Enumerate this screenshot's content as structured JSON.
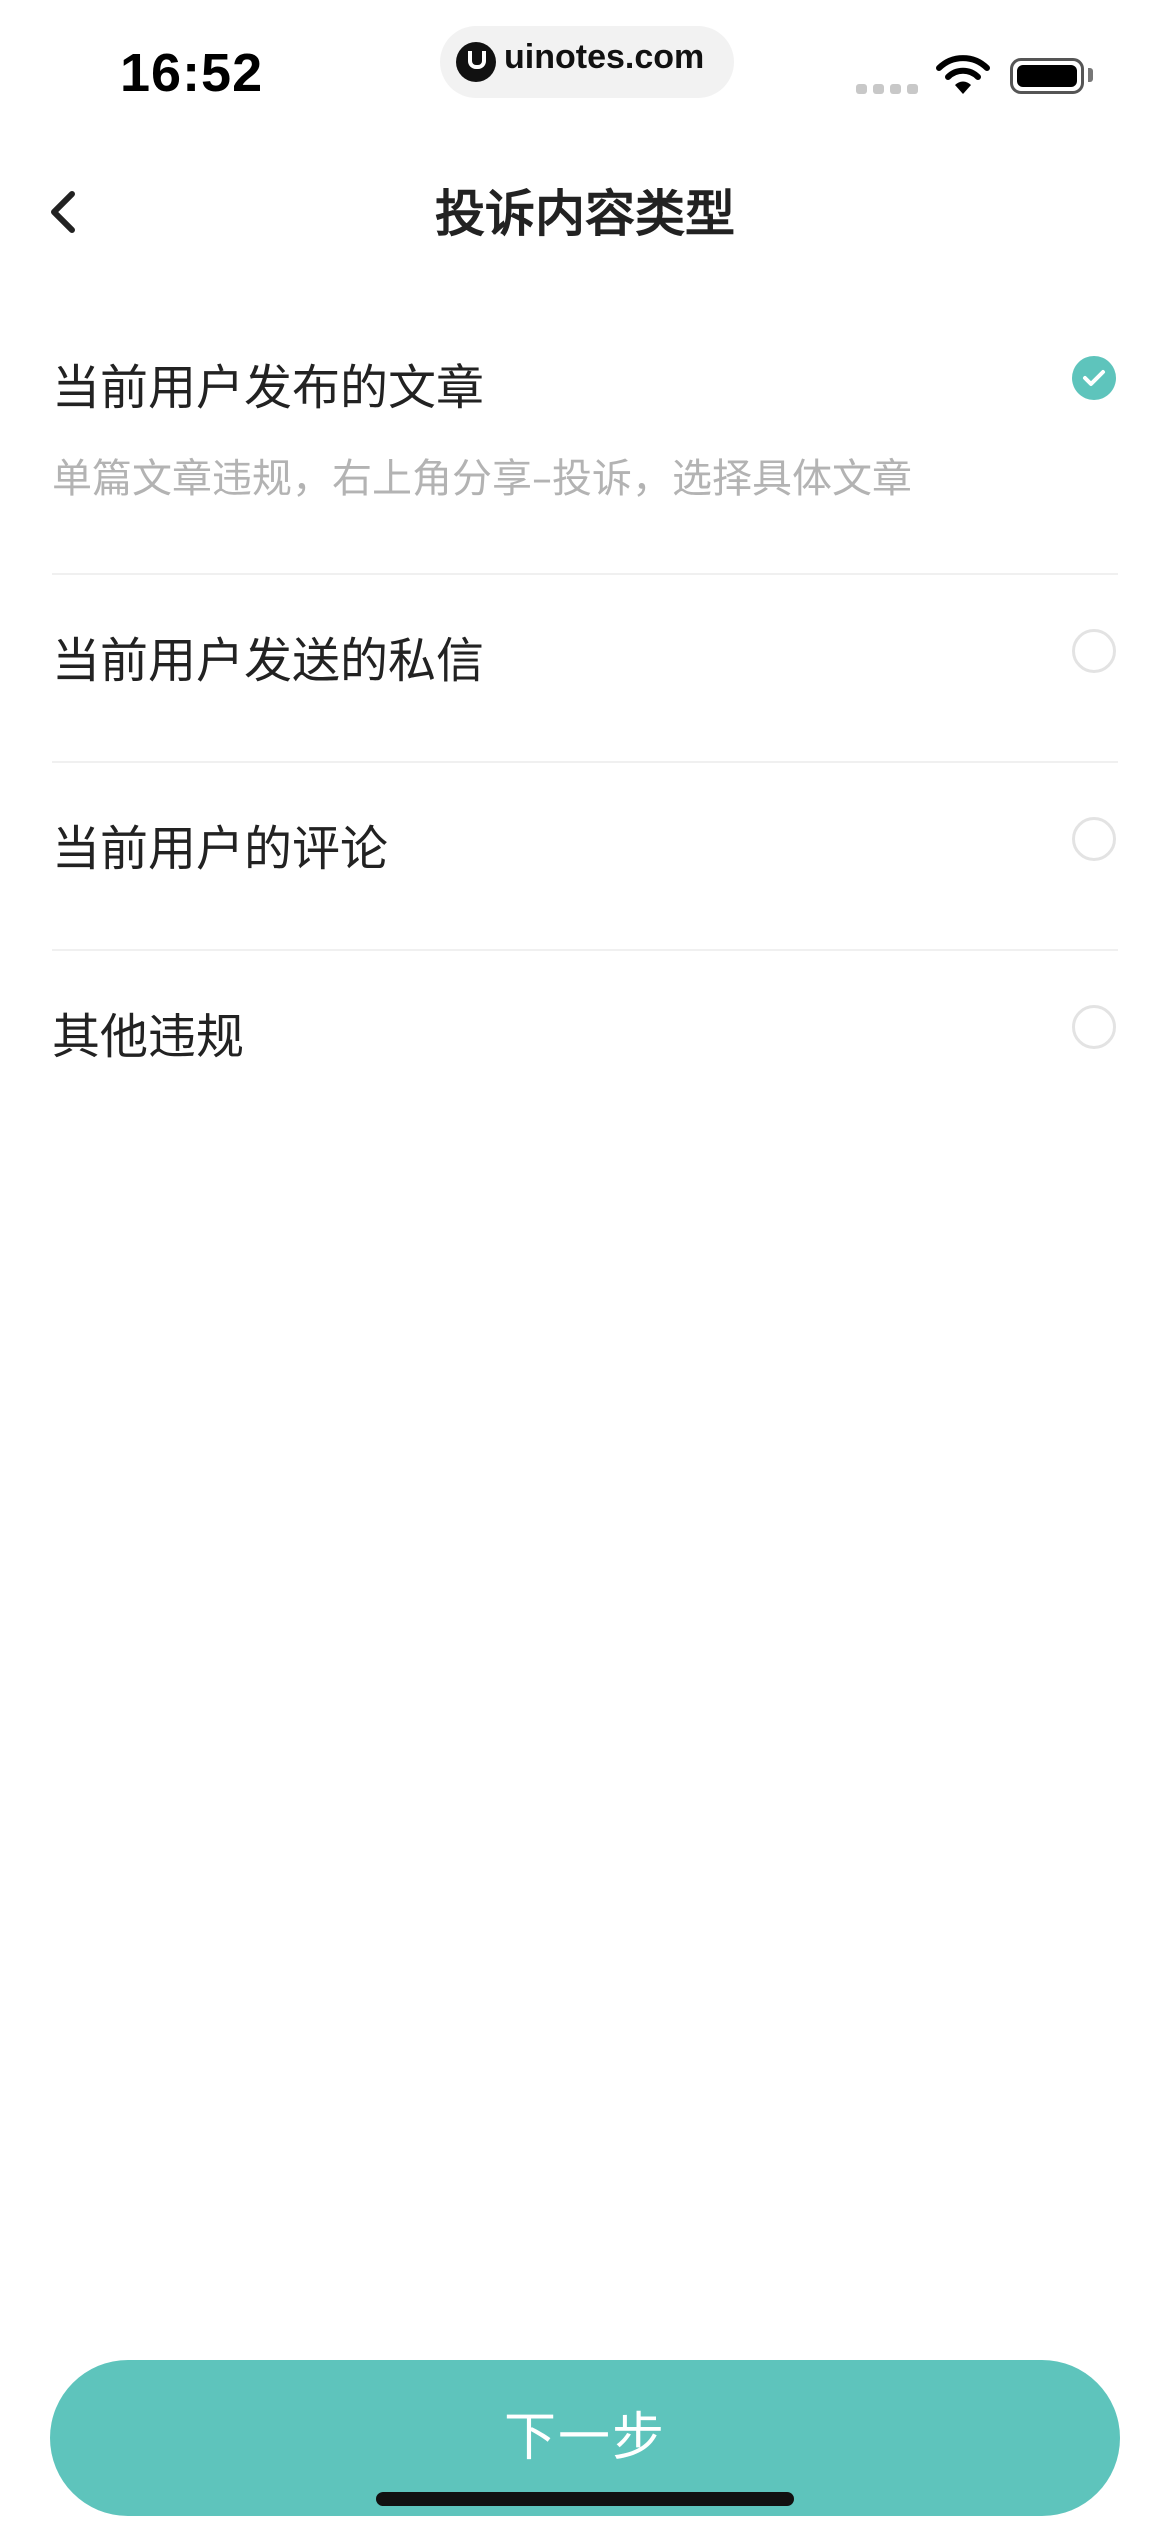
{
  "status_bar": {
    "time": "16:52",
    "url": "uinotes.com"
  },
  "nav": {
    "title": "投诉内容类型"
  },
  "options": [
    {
      "label": "当前用户发布的文章",
      "description": "单篇文章违规，右上角分享–投诉，选择具体文章",
      "selected": true
    },
    {
      "label": "当前用户发送的私信",
      "selected": false
    },
    {
      "label": "当前用户的评论",
      "selected": false
    },
    {
      "label": "其他违规",
      "selected": false
    }
  ],
  "footer": {
    "next_label": "下一步"
  },
  "colors": {
    "accent": "#5ec4bc",
    "text": "#222222",
    "muted": "#b3b3b3"
  }
}
